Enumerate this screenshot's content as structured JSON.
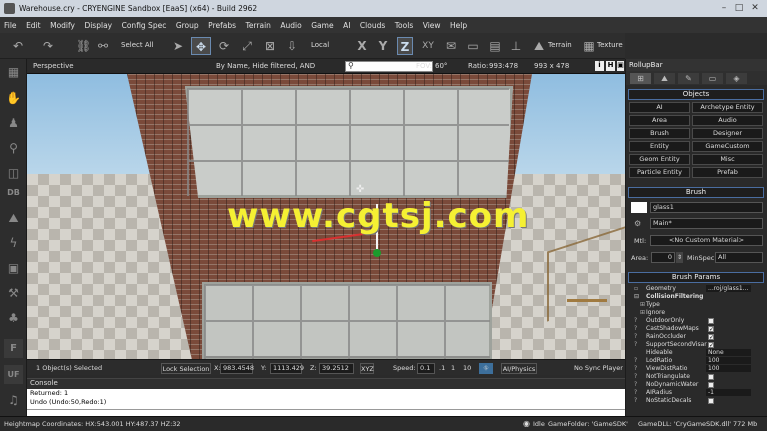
{
  "window": {
    "title": "Warehouse.cry - CRYENGINE Sandbox [EaaS] (x64) - Build 2962"
  },
  "menu": [
    "File",
    "Edit",
    "Modify",
    "Display",
    "Config Spec",
    "Group",
    "Prefabs",
    "Terrain",
    "Audio",
    "Game",
    "AI",
    "Clouds",
    "Tools",
    "View",
    "Help"
  ],
  "toolbar": {
    "select_all": "Select All",
    "coord": "Local",
    "terrain": "Terrain",
    "texture": "Texture",
    "axis_x": "X",
    "axis_y": "Y",
    "axis_z": "Z",
    "axis_xy": "XY"
  },
  "left_tools": {
    "db": "DB",
    "f": "F",
    "uf": "UF"
  },
  "viewport": {
    "name": "Perspective",
    "filter": "By Name, Hide filtered, AND",
    "fov_label": "FOV:",
    "fov": "60°",
    "ratio_label": "Ratio:",
    "ratio": "993:478",
    "size": "993 x 478",
    "btn_i": "i",
    "btn_h": "H",
    "watermark": "www.cgtsj.com"
  },
  "status": {
    "selection": "1 Object(s) Selected",
    "lock": "Lock Selection",
    "x_label": "X:",
    "x": "983.4548",
    "y_label": "Y:",
    "y": "1113.429",
    "z_label": "Z:",
    "z": "39.2512",
    "xyz": "XYZ",
    "speed_label": "Speed:",
    "speed": "0.1",
    "s1": ".1",
    "s2": "1",
    "s3": "10",
    "ai": "AI/Physics",
    "sync": "No Sync Player"
  },
  "console": {
    "title": "Console",
    "lines": [
      "Returned: 1",
      "Undo (Undo:50,Redo:1)"
    ]
  },
  "bottom": {
    "heightmap": "Heightmap Coordinates: HX:543.001 HY:487.37 HZ:32",
    "idle": "Idle",
    "gamefolder": "GameFolder: 'GameSDK'",
    "gamedll": "GameDLL: 'CryGameSDK.dll'",
    "memory": "772 Mb"
  },
  "rollup": {
    "title": "RollupBar",
    "objects_header": "Objects",
    "object_buttons": [
      "AI",
      "Archetype Entity",
      "Area",
      "Audio",
      "Brush",
      "Designer",
      "Entity",
      "GameCustom",
      "Geom Entity",
      "Misc",
      "Particle Entity",
      "Prefab"
    ],
    "brush_header": "Brush",
    "brush_name": "glass1",
    "brush_layer": "Main*",
    "mtl_label": "Mtl:",
    "mtl_value": "<No Custom Material>",
    "area_label": "Area:",
    "area_value": "0",
    "minspec_label": "MinSpec:",
    "minspec_value": "All",
    "params_header": "Brush Params",
    "params": [
      {
        "name": "Geometry",
        "value": "...roj/glass1...",
        "kind": "text"
      },
      {
        "name": "CollisionFiltering",
        "value": "",
        "kind": "group"
      },
      {
        "name": "Type",
        "value": "",
        "kind": "sub"
      },
      {
        "name": "Ignore",
        "value": "",
        "kind": "sub"
      },
      {
        "name": "OutdoorOnly",
        "value": "",
        "kind": "check"
      },
      {
        "name": "CastShadowMaps",
        "value": "✓",
        "kind": "check"
      },
      {
        "name": "RainOccluder",
        "value": "✓",
        "kind": "check"
      },
      {
        "name": "SupportSecondVisar",
        "value": "✓",
        "kind": "check"
      },
      {
        "name": "Hideable",
        "value": "None",
        "kind": "text"
      },
      {
        "name": "LodRatio",
        "value": "100",
        "kind": "text"
      },
      {
        "name": "ViewDistRatio",
        "value": "100",
        "kind": "text"
      },
      {
        "name": "NotTriangulate",
        "value": "",
        "kind": "check"
      },
      {
        "name": "NoDynamicWater",
        "value": "",
        "kind": "check"
      },
      {
        "name": "AIRadius",
        "value": "-1",
        "kind": "text"
      },
      {
        "name": "NoStaticDecals",
        "value": "",
        "kind": "check"
      }
    ]
  }
}
